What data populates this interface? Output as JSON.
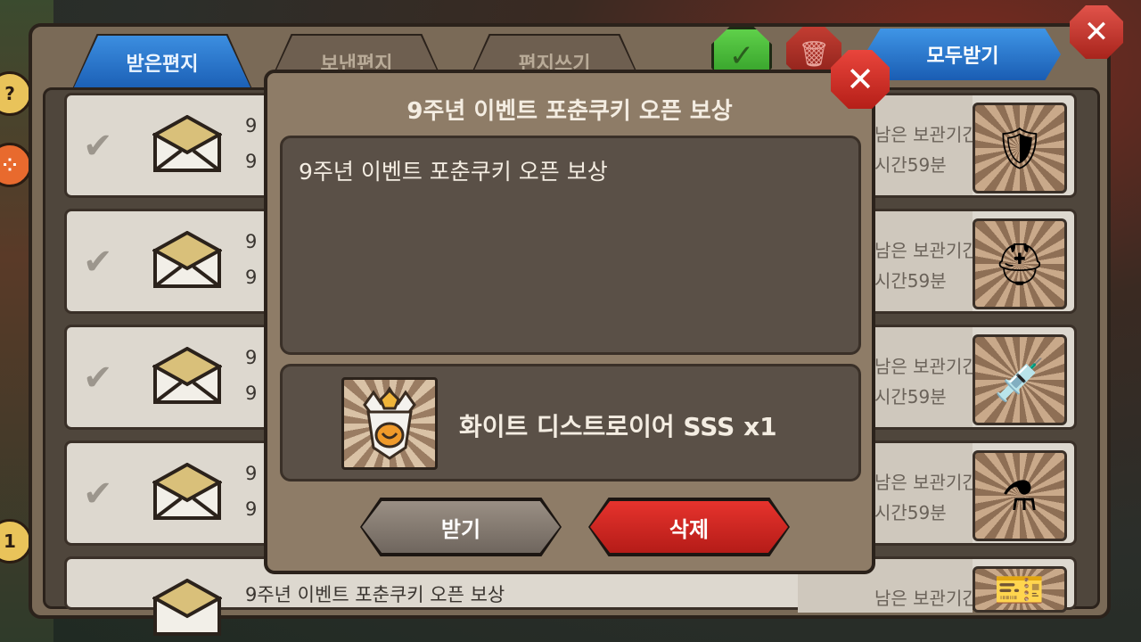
{
  "tabs": {
    "received": "받은편지",
    "sent": "보낸편지",
    "write": "편지쓰기"
  },
  "toolbar": {
    "receive_all": "모두받기",
    "check_icon": "check-icon",
    "trash_icon": "trash-icon",
    "close_icon": "close-icon"
  },
  "mail_list": {
    "rows": [
      {
        "title": "9주년 이벤트 포춘쿠키 오픈 보상",
        "sub": "9",
        "keep1": "남은 보관기간",
        "keep2": "시간59분",
        "item_icon": "armor-icon"
      },
      {
        "title": "9주년 이벤트 포춘쿠키 오픈 보상",
        "sub": "9",
        "keep1": "남은 보관기간",
        "keep2": "시간59분",
        "item_icon": "helmet-icon"
      },
      {
        "title": "9주년 이벤트 포춘쿠키 오픈 보상",
        "sub": "9",
        "keep1": "남은 보관기간",
        "keep2": "시간59분",
        "item_icon": "syringe-icon"
      },
      {
        "title": "9주년 이벤트 포춘쿠키 오픈 보상",
        "sub": "9",
        "keep1": "남은 보관기간",
        "keep2": "시간59분",
        "item_icon": "potion-icon"
      },
      {
        "title": "9주년 이벤트 포춘쿠키 오픈 보상",
        "sub": "",
        "keep1": "남은 보관기간",
        "keep2": "",
        "item_icon": "ticket-icon"
      }
    ]
  },
  "modal": {
    "title": "9주년 이벤트 포춘쿠키 오픈 보상",
    "message": "9주년 이벤트 포춘쿠키 오픈 보상",
    "reward_name": "화이트 디스트로이어 SSS x1",
    "reward_icon": "white-armor-icon",
    "receive_label": "받기",
    "delete_label": "삭제"
  }
}
